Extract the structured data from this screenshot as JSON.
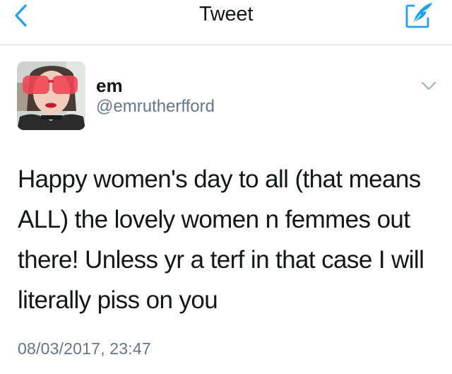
{
  "nav": {
    "title": "Tweet",
    "back_icon": "chevron-left-icon",
    "compose_icon": "compose-feather-icon"
  },
  "tweet": {
    "author": {
      "display_name": "em",
      "handle": "@emrutherfford"
    },
    "text": "Happy women's day to all (that means ALL) the lovely women n femmes out there! Unless yr a terf in that case I will literally piss on you",
    "timestamp": "08/03/2017, 23:47",
    "menu_icon": "chevron-down-icon"
  },
  "colors": {
    "accent": "#1da1f2",
    "text_primary": "#14171a",
    "text_secondary": "#657786",
    "divider": "#d6d9dc",
    "caret": "#aab8c2"
  }
}
